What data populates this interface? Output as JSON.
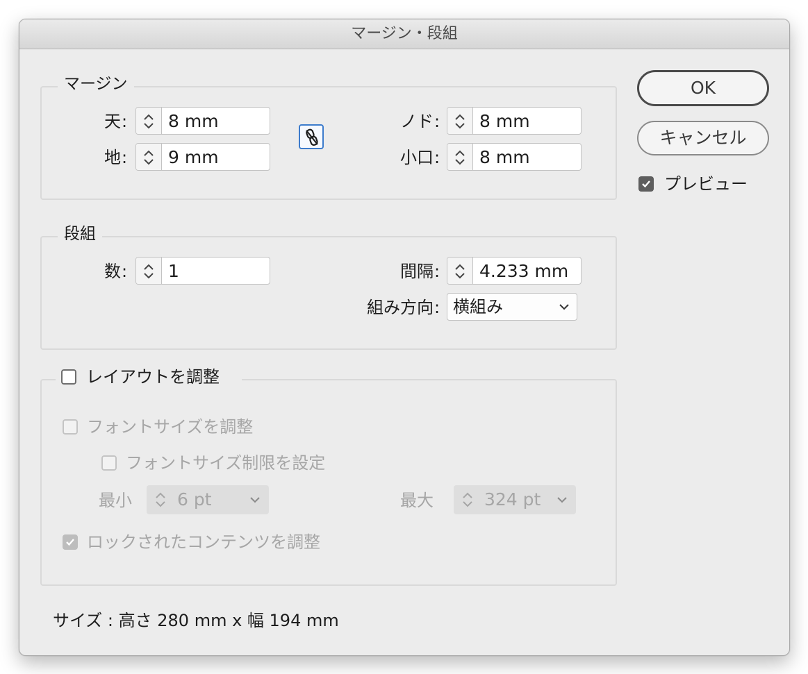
{
  "window": {
    "title": "マージン・段組"
  },
  "margin": {
    "legend": "マージン",
    "top": {
      "label": "天",
      "value": "8 mm"
    },
    "bottom": {
      "label": "地",
      "value": "9 mm"
    },
    "inside": {
      "label": "ノド",
      "value": "8 mm"
    },
    "outside": {
      "label": "小口",
      "value": "8 mm"
    },
    "link_icon": "unlinked-chain-icon"
  },
  "columns": {
    "legend": "段組",
    "number": {
      "label": "数",
      "value": "1"
    },
    "gutter": {
      "label": "間隔",
      "value": "4.233 mm"
    },
    "writing_direction": {
      "label": "組み方向",
      "value": "横組み"
    }
  },
  "layout_adjust": {
    "label": "レイアウトを調整",
    "checked": false,
    "font_size": {
      "label": "フォントサイズを調整",
      "checked": false
    },
    "font_size_limit": {
      "label": "フォントサイズ制限を設定",
      "checked": false
    },
    "min": {
      "label": "最小",
      "value": "6 pt"
    },
    "max": {
      "label": "最大",
      "value": "324 pt"
    },
    "locked_content": {
      "label": "ロックされたコンテンツを調整",
      "checked": true
    }
  },
  "size_info": "サイズ : 高さ 280 mm x 幅 194 mm",
  "buttons": {
    "ok": "OK",
    "cancel": "キャンセル"
  },
  "preview": {
    "label": "プレビュー",
    "checked": true
  },
  "colon": ":",
  "colors": {
    "accent": "#3d7ccc",
    "background": "#ececec"
  }
}
